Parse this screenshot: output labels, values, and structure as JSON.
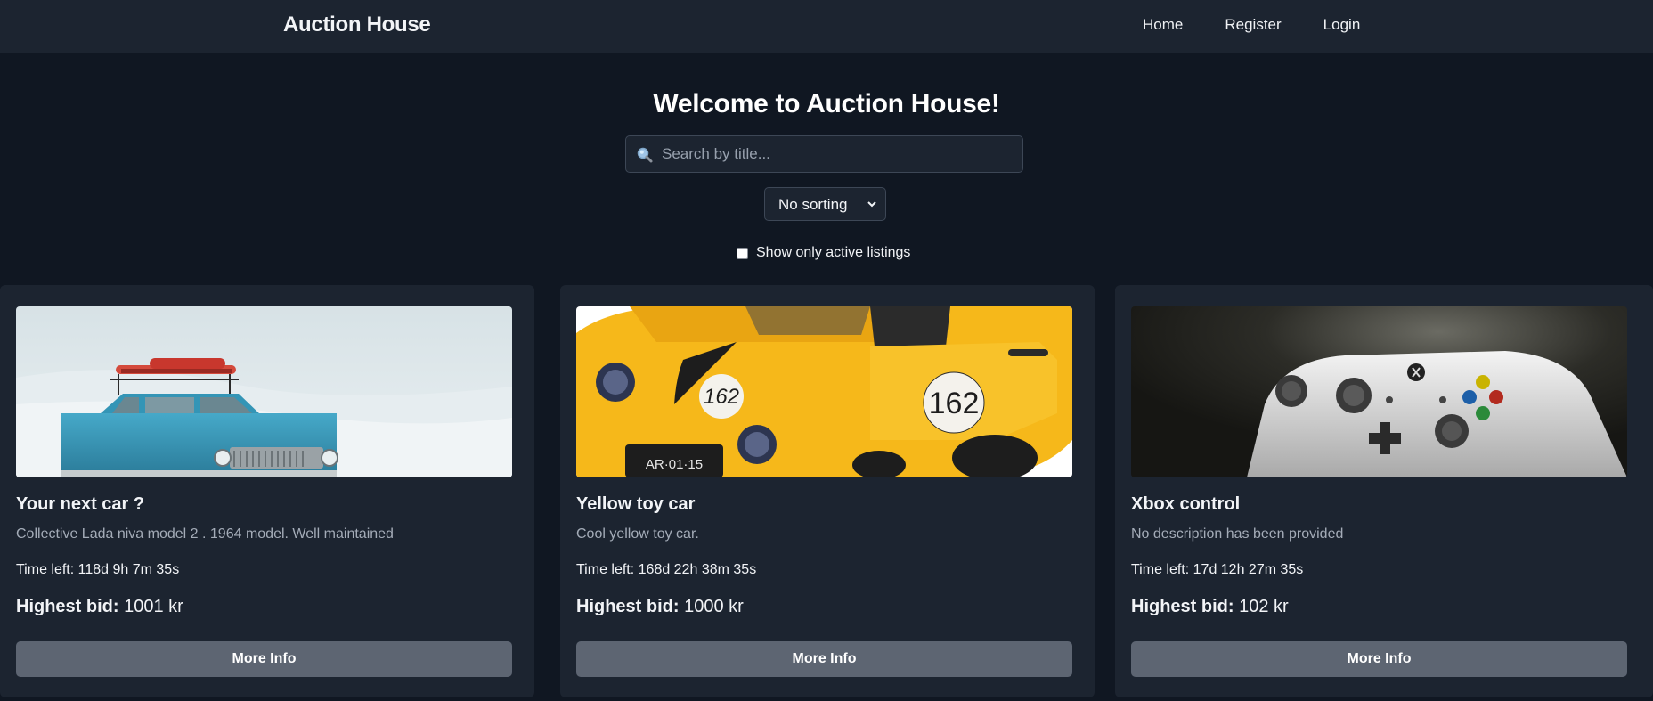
{
  "navbar": {
    "brand": "Auction House",
    "links": {
      "home": "Home",
      "register": "Register",
      "login": "Login"
    }
  },
  "hero": {
    "title": "Welcome to Auction House!"
  },
  "search": {
    "placeholder": "Search by title..."
  },
  "sort": {
    "selected": "No sorting"
  },
  "filter": {
    "active_label": "Show only active listings",
    "checked": false
  },
  "listings": [
    {
      "title": "Your next car ?",
      "description": "Collective Lada niva model 2 . 1964 model. Well maintained",
      "time_left": "Time left: 118d 9h 7m 35s",
      "bid_label": "Highest bid:",
      "bid_value": "1001 kr",
      "button": "More Info"
    },
    {
      "title": "Yellow toy car",
      "description": "Cool yellow toy car.",
      "time_left": "Time left: 168d 22h 38m 35s",
      "bid_label": "Highest bid:",
      "bid_value": "1000 kr",
      "button": "More Info",
      "image_text": {
        "number": "162",
        "plate": "AR·01·15"
      }
    },
    {
      "title": "Xbox control",
      "description": "No description has been provided",
      "time_left": "Time left: 17d 12h 27m 35s",
      "bid_label": "Highest bid:",
      "bid_value": "102 kr",
      "button": "More Info"
    }
  ]
}
